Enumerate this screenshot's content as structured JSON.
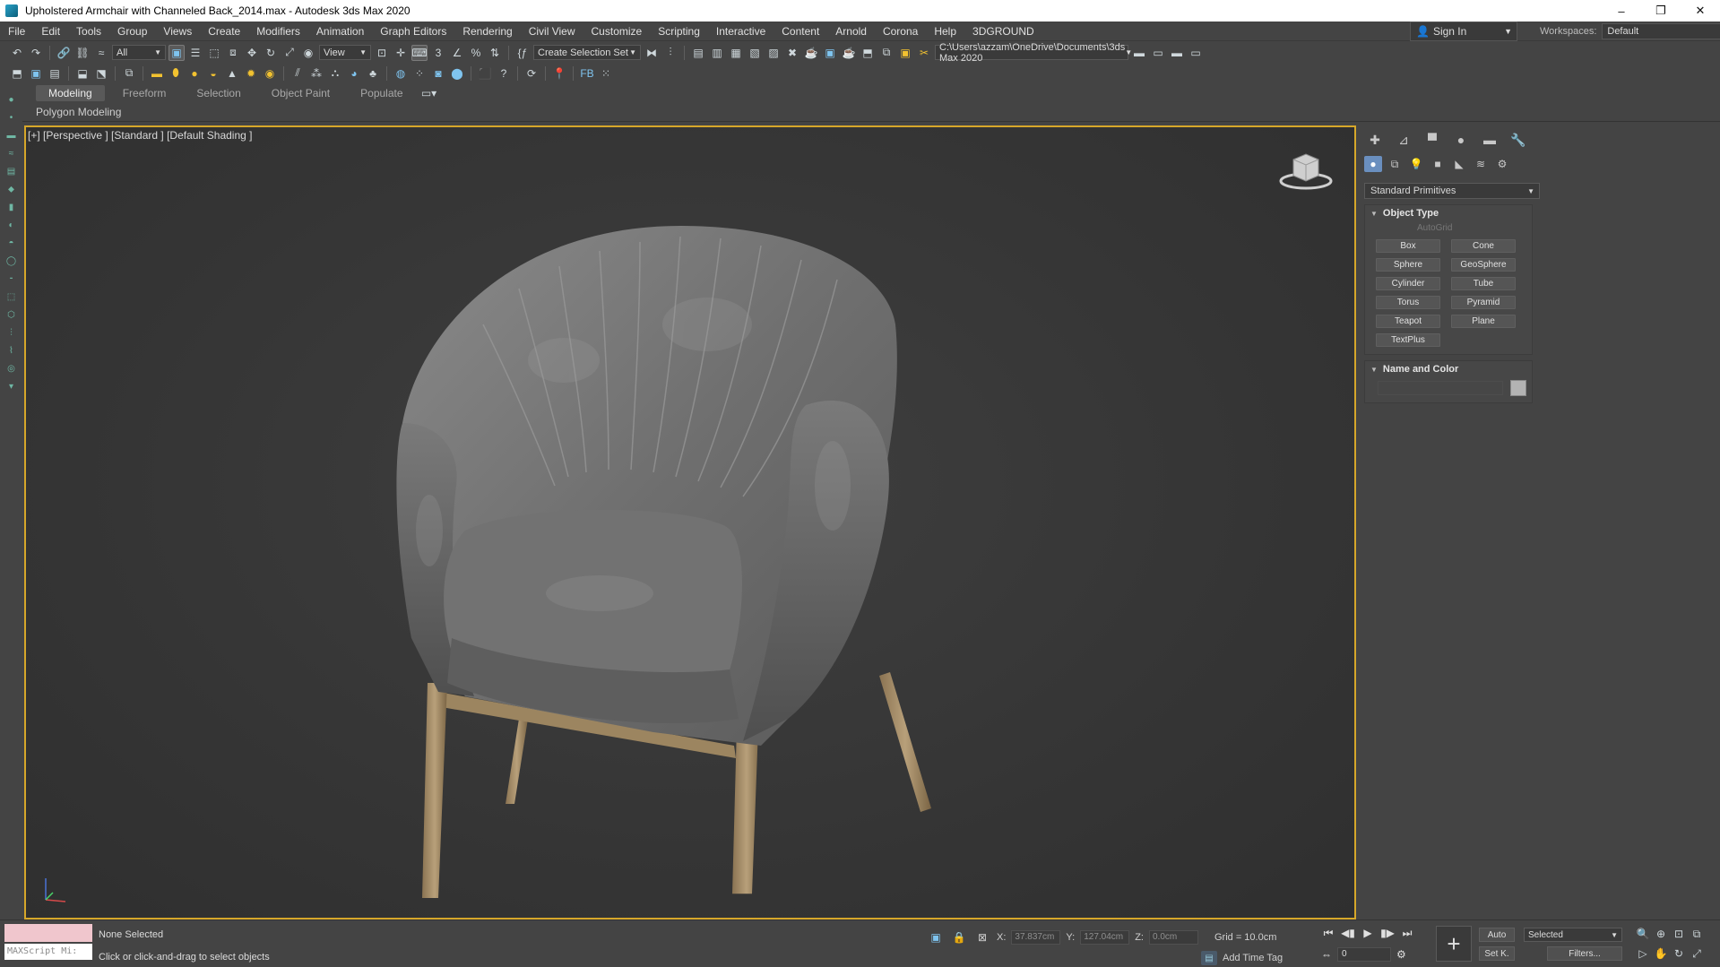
{
  "window": {
    "title": "Upholstered Armchair with Channeled Back_2014.max - Autodesk 3ds Max 2020",
    "minimize": "–",
    "restore": "❐",
    "close": "✕"
  },
  "menu": [
    "File",
    "Edit",
    "Tools",
    "Group",
    "Views",
    "Create",
    "Modifiers",
    "Animation",
    "Graph Editors",
    "Rendering",
    "Civil View",
    "Customize",
    "Scripting",
    "Interactive",
    "Content",
    "Arnold",
    "Corona",
    "Help",
    "3DGROUND"
  ],
  "account": {
    "sign_in": "Sign In"
  },
  "workspaces": {
    "label": "Workspaces:",
    "value": "Default"
  },
  "toolbar": {
    "selection_filter": "All",
    "reference_coord": "View",
    "named_selection": "Create Selection Set",
    "project_path": "C:\\Users\\azzam\\OneDrive\\Documents\\3ds Max 2020"
  },
  "ribbon": {
    "tabs": [
      "Modeling",
      "Freeform",
      "Selection",
      "Object Paint",
      "Populate"
    ],
    "active_tab": "Modeling",
    "panel_label": "Polygon Modeling"
  },
  "viewport": {
    "label": "[+] [Perspective ] [Standard ] [Default Shading ]",
    "active_border_color": "#d6a72a",
    "object": "upholstered armchair"
  },
  "command_panel": {
    "category": "Standard Primitives",
    "object_type": {
      "header": "Object Type",
      "autogrid": "AutoGrid",
      "buttons": [
        "Box",
        "Cone",
        "Sphere",
        "GeoSphere",
        "Cylinder",
        "Tube",
        "Torus",
        "Pyramid",
        "Teapot",
        "Plane",
        "TextPlus"
      ]
    },
    "name_and_color": {
      "header": "Name and Color",
      "name": "",
      "color": "#b3b3b3"
    }
  },
  "status": {
    "maxscript": "MAXScript Mi:",
    "selection": "None Selected",
    "prompt": "Click or click-and-drag to select objects",
    "x_label": "X:",
    "x": "37.837cm",
    "y_label": "Y:",
    "y": "127.04cm",
    "z_label": "Z:",
    "z": "0.0cm",
    "grid": "Grid = 10.0cm",
    "add_time_tag": "Add Time Tag",
    "frame": "0",
    "auto_key": "Auto",
    "set_key": "Set K.",
    "key_filter": "Selected",
    "filters": "Filters..."
  }
}
